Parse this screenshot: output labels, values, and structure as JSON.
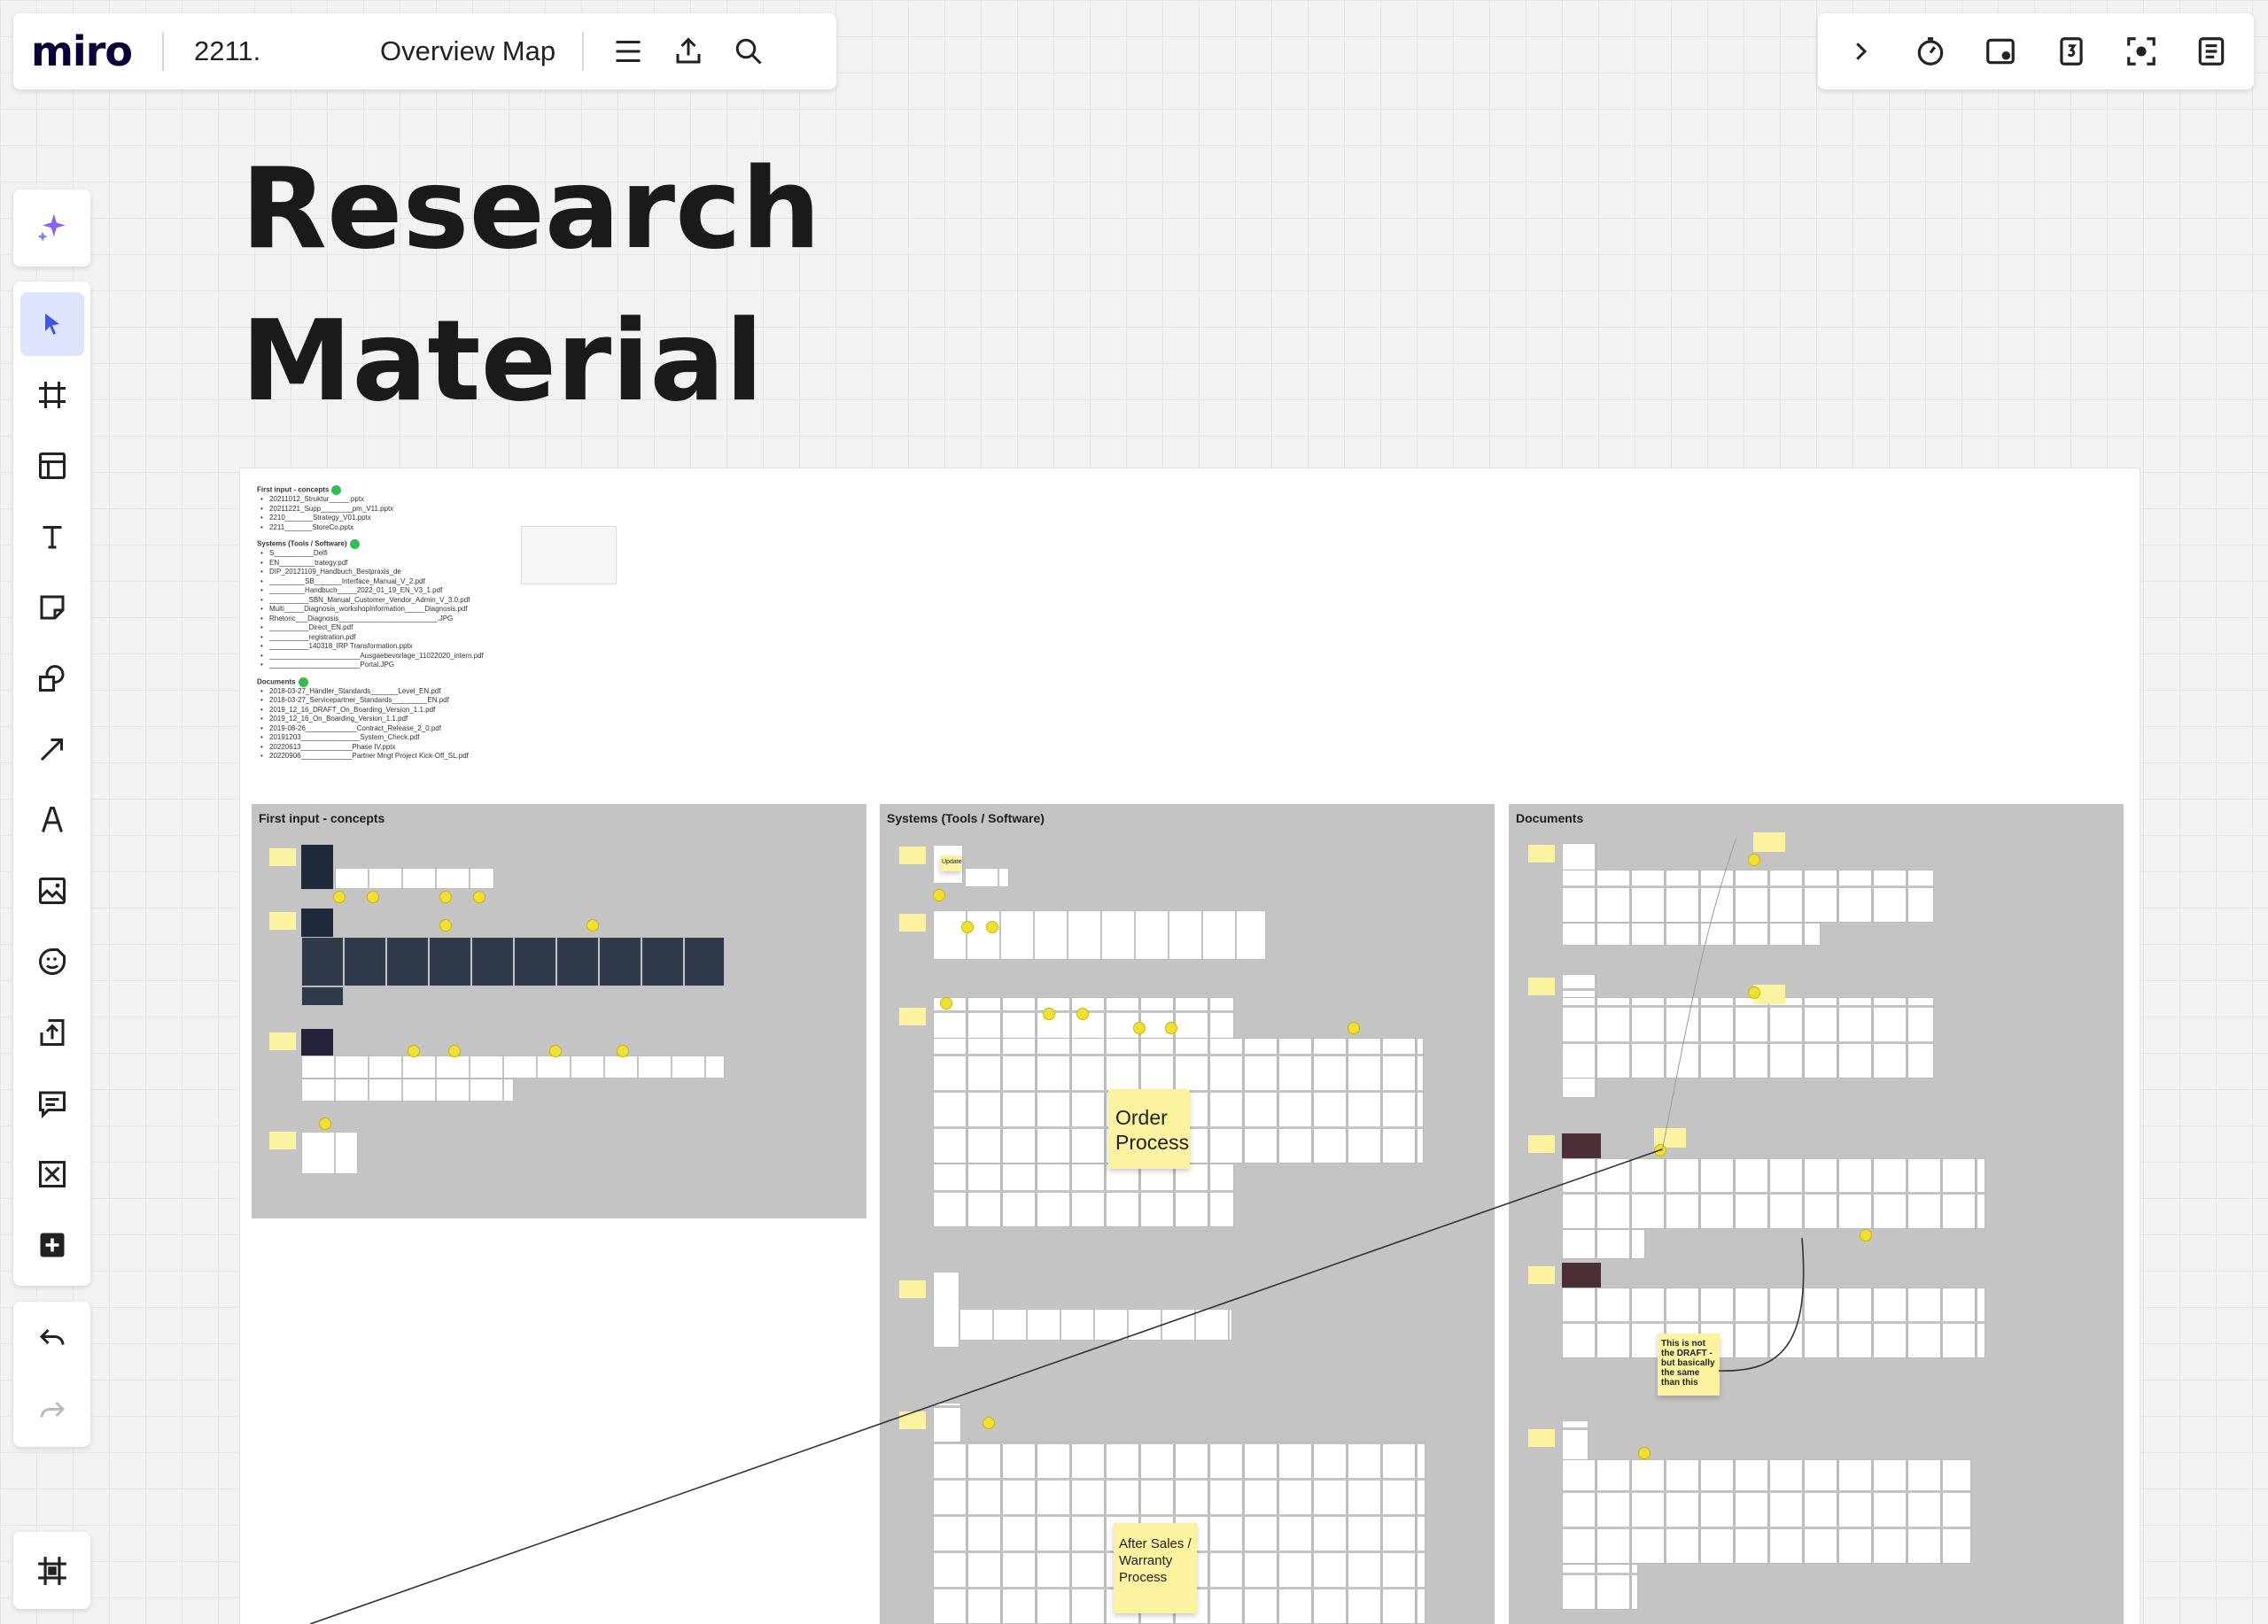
{
  "app": {
    "logo": "miro",
    "board_id": "2211.",
    "board_name": "Overview Map"
  },
  "title": {
    "line1": "Research",
    "line2": "Material"
  },
  "notes": {
    "heading1": "First input - concepts",
    "items1": [
      "20211012_Struktur_____.pptx",
      "20211221_Supp________pm_V11.pptx",
      "2210_______Strategy_V01.pptx",
      "2211_______StoreCo.pptx"
    ],
    "heading2": "Systems (Tools / Software)",
    "items2": [
      "S__________Delfi",
      "EN_________trategy.pdf",
      "DIP_20121109_Handbuch_Bestpraxis_de",
      "_________SB_______Interface_Manual_V_2.pdf",
      "_________Handbuch_____2022_01_19_EN_V3_1.pdf",
      "__________SBN_Manual_Customer_Vendor_Admin_V_3.0.pdf",
      "Multi_____Diagnosis_workshopInformation_____Diagnosis.pdf",
      "Rhetoric___Diagnosis_________________________.JPG",
      "__________Direct_EN.pdf",
      "__________registration.pdf",
      "__________140318_IRP Transformation.pptx",
      "_______________________Ausgaebevorlage_11022020_intern.pdf",
      "_______________________Portal.JPG"
    ],
    "heading3": "Documents",
    "items3": [
      "2018-03-27_Händler_Standards_______Level_EN.pdf",
      "2018-03-27_Servicepartner_Standards_________EN.pdf",
      "2019_12_16_DRAFT_On_Boarding_Version_1.1.pdf",
      "2019_12_16_On_Boarding_Version_1.1.pdf",
      "2019-08-26_____________Contract_Release_2_0.pdf",
      "20191203_______________System_Check.pdf",
      "20220613_____________Phase IV.pptx",
      "20220906_____________Partner Mngt Project Kick-Off_SL.pdf"
    ]
  },
  "sections": {
    "concepts": "First input - concepts",
    "systems": "Systems (Tools / Software)",
    "documents": "Documents"
  },
  "stickies": {
    "order_process": "Order Process",
    "after_sales": "After Sales / Warranty Process",
    "draft_note": "This is not the DRAFT - but basically the same than this",
    "update": "Update"
  },
  "icons": {
    "top_left": [
      "menu-icon",
      "export-icon",
      "search-icon"
    ],
    "top_right": [
      "chevron-right-icon",
      "timer-icon",
      "screen-share-icon",
      "counter-icon",
      "focus-icon",
      "notes-icon"
    ],
    "tools": [
      "select-icon",
      "frame-icon",
      "templates-icon",
      "text-icon",
      "sticky-note-icon",
      "shapes-icon",
      "connector-icon",
      "pen-icon",
      "image-icon",
      "sticker-icon",
      "upload-icon",
      "comment-icon",
      "close-box-icon",
      "add-icon"
    ]
  },
  "colors": {
    "accent": "#4262ff",
    "sticky": "#fbf3a0",
    "section_bg": "#c4c4c4"
  }
}
